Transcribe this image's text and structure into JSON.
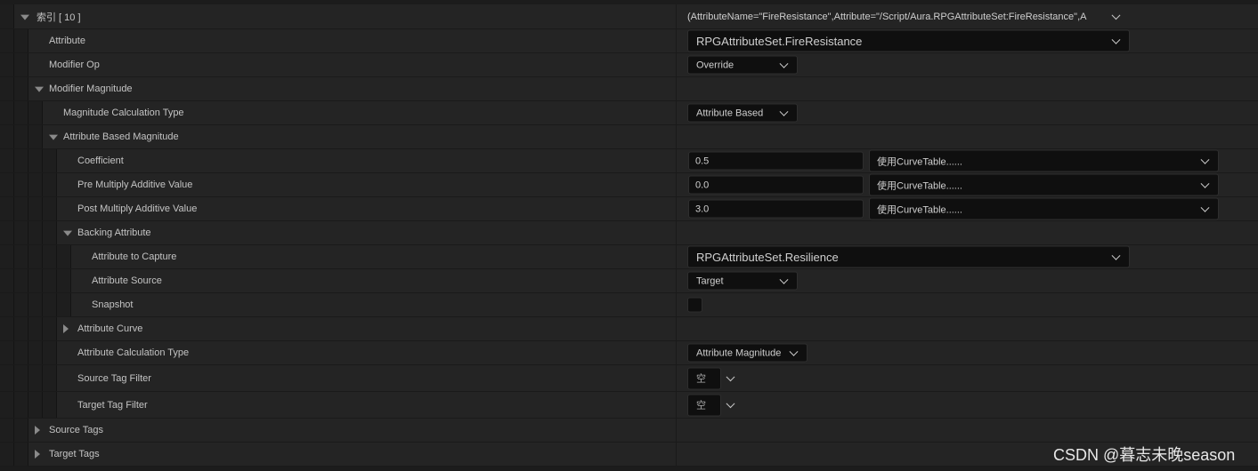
{
  "rows": [
    {
      "level": 0,
      "label": "索引 [ 10 ]",
      "expand": "open",
      "value": {
        "type": "summary",
        "text": "(AttributeName=\"FireResistance\",Attribute=\"/Script/Aura.RPGAttributeSet:FireResistance\",A"
      }
    },
    {
      "level": 1,
      "label": "Attribute",
      "value": {
        "type": "combo",
        "text": "RPGAttributeSet.FireResistance",
        "size": "wide"
      }
    },
    {
      "level": 1,
      "label": "Modifier Op",
      "value": {
        "type": "combo",
        "text": "Override",
        "size": "small"
      }
    },
    {
      "level": 1,
      "label": "Modifier Magnitude",
      "expand": "open"
    },
    {
      "level": 2,
      "label": "Magnitude Calculation Type",
      "value": {
        "type": "combo",
        "text": "Attribute Based",
        "size": "small"
      }
    },
    {
      "level": 2,
      "label": "Attribute Based Magnitude",
      "expand": "open"
    },
    {
      "level": 3,
      "label": "Coefficient",
      "value": {
        "type": "scalable",
        "number": "0.5",
        "curve": "使用CurveTable......"
      }
    },
    {
      "level": 3,
      "label": "Pre Multiply Additive Value",
      "value": {
        "type": "scalable",
        "number": "0.0",
        "curve": "使用CurveTable......"
      }
    },
    {
      "level": 3,
      "label": "Post Multiply Additive Value",
      "value": {
        "type": "scalable",
        "number": "3.0",
        "curve": "使用CurveTable......"
      }
    },
    {
      "level": 3,
      "label": "Backing Attribute",
      "expand": "open"
    },
    {
      "level": 4,
      "label": "Attribute to Capture",
      "value": {
        "type": "combo",
        "text": "RPGAttributeSet.Resilience",
        "size": "wide"
      }
    },
    {
      "level": 4,
      "label": "Attribute Source",
      "value": {
        "type": "combo",
        "text": "Target",
        "size": "small"
      }
    },
    {
      "level": 4,
      "label": "Snapshot",
      "value": {
        "type": "checkbox",
        "checked": false
      }
    },
    {
      "level": 3,
      "label": "Attribute Curve",
      "expand": "closed"
    },
    {
      "level": 3,
      "label": "Attribute Calculation Type",
      "value": {
        "type": "combo",
        "text": "Attribute Magnitude",
        "size": "medium"
      }
    },
    {
      "level": 3,
      "label": "Source Tag Filter",
      "value": {
        "type": "tag",
        "text": "空"
      }
    },
    {
      "level": 3,
      "label": "Target Tag Filter",
      "value": {
        "type": "tag",
        "text": "空"
      }
    },
    {
      "level": 1,
      "label": "Source Tags",
      "expand": "closed"
    },
    {
      "level": 1,
      "label": "Target Tags",
      "expand": "closed"
    }
  ],
  "watermark": "CSDN @暮志未晚season"
}
